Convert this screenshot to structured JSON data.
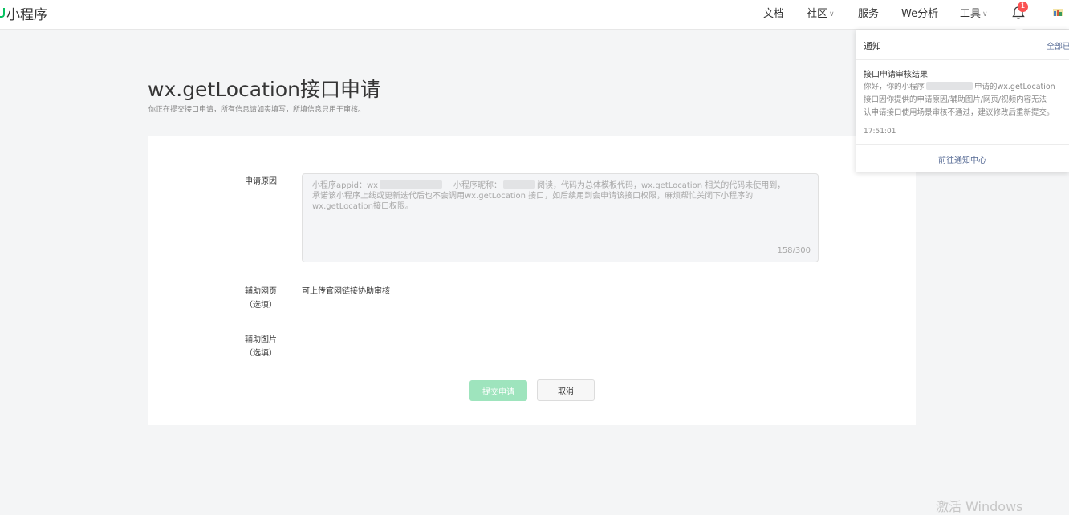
{
  "header": {
    "brand": "小程序",
    "nav": {
      "docs": "文档",
      "community": "社区",
      "services": "服务",
      "we_analysis": "We分析",
      "tools": "工具"
    },
    "notification_count": "1"
  },
  "page": {
    "title": "wx.getLocation接口申请",
    "subtitle": "你正在提交接口申请，所有信息请如实填写，所填信息只用于审核。"
  },
  "form": {
    "reason_label": "申请原因",
    "reason_text": {
      "part1": "小程序appid：wx",
      "part2": "小程序昵称：",
      "part3": "阅读，代码为总体模板代码，wx.getLocation 相关的代码未使用到，",
      "line2": "承诺该小程序上线或更新迭代后也不会调用wx.getLocation 接口，如后续用到会申请该接口权限，麻烦帮忙关闭下小程序的",
      "line3": "wx.getLocation接口权限。"
    },
    "reason_counter": "158/300",
    "webpage_label": "辅助网页",
    "webpage_optional": "（选填）",
    "webpage_hint": "可上传官网链接协助审核",
    "image_label": "辅助图片",
    "image_optional": "（选填）",
    "submit_label": "提交申请",
    "cancel_label": "取消"
  },
  "notifications": {
    "title": "通知",
    "read_all": "全部已读",
    "items": [
      {
        "title": "接口申请审核结果",
        "body_line1_a": "你好，你的小程序",
        "body_line1_b": "申请的wx.getLocation",
        "body_line2": "接口因你提供的申请原因/辅助图片/网页/视频内容无法",
        "body_line3": "认申请接口使用场景审核不通过，建议修改后重新提交。",
        "time": "17:51:01"
      }
    ],
    "footer_link": "前往通知中心"
  },
  "watermark": "激活 Windows",
  "colors": {
    "brand_green": "#07c160",
    "badge_red": "#fa5151",
    "link_blue": "#576b95"
  }
}
